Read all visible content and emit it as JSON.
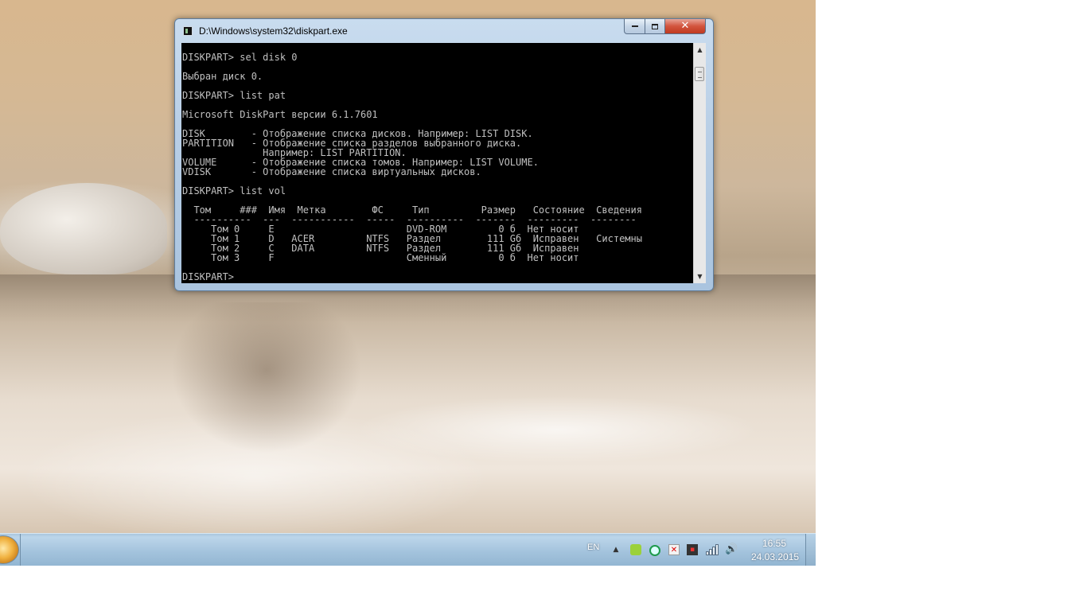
{
  "window": {
    "title": "D:\\Windows\\system32\\diskpart.exe",
    "minimize_label": "▭",
    "maximize_label": "□",
    "close_label": "✕"
  },
  "console": {
    "lines": [
      "",
      "DISKPART> sel disk 0",
      "",
      "Выбран диск 0.",
      "",
      "DISKPART> list pat",
      "",
      "Microsoft DiskPart версии 6.1.7601",
      "",
      "DISK        - Отображение списка дисков. Например: LIST DISK.",
      "PARTITION   - Отображение списка разделов выбранного диска.",
      "              Например: LIST PARTITION.",
      "VOLUME      - Отображение списка томов. Например: LIST VOLUME.",
      "VDISK       - Отображение списка виртуальных дисков.",
      "",
      "DISKPART> list vol",
      "",
      "  Том     ###  Имя  Метка        ФС     Тип         Размер   Состояние  Сведения",
      "  ----------  ---  -----------  -----  ----------  -------  ---------  --------",
      "     Том 0     E                       DVD-ROM         0 б  Нет носит",
      "     Том 1     D   ACER         NTFS   Раздел        111 Gб  Исправен   Системны",
      "     Том 2     C   DATA         NTFS   Раздел        111 Gб  Исправен",
      "     Том 3     F                       Сменный         0 б  Нет носит",
      "",
      "DISKPART> "
    ]
  },
  "scrollbar": {
    "up_arrow": "▲",
    "down_arrow": "▼"
  },
  "taskbar": {
    "language": "EN",
    "show_hidden_icons": "▲",
    "volume_glyph": "🔊",
    "time": "16:55",
    "date": "24.03.2015"
  },
  "colors": {
    "console_background": "#000000",
    "console_text": "#c0c0c0",
    "close_button": "#c0391f",
    "window_frame": "#b9cfe6"
  }
}
